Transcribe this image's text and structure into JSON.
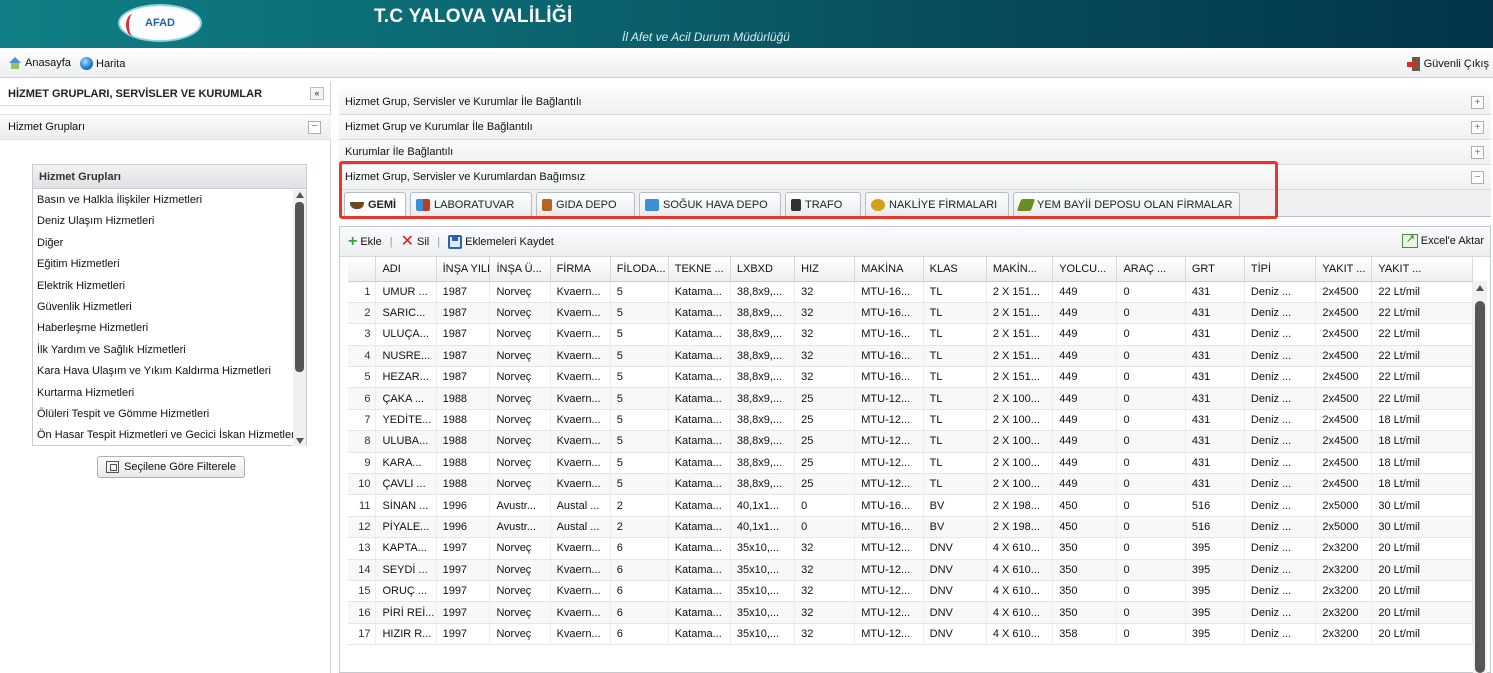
{
  "header": {
    "logo_text": "AFAD",
    "title": "T.C YALOVA VALİLİĞİ",
    "subtitle": "İl Afet ve Acil Durum Müdürlüğü"
  },
  "nav": {
    "home": "Anasayfa",
    "map": "Harita",
    "logout": "Güvenli Çıkış"
  },
  "left_panel": {
    "title": "HİZMET GRUPLARI, SERVİSLER VE KURUMLAR",
    "collapse_icon": "«",
    "section_label": "Hizmet Grupları",
    "section_toggle": "−",
    "group_box_title": "Hizmet Grupları",
    "groups": [
      "Basın ve Halkla İlişkiler Hizmetleri",
      "Deniz Ulaşım Hizmetleri",
      "Diğer",
      "Eğitim Hizmetleri",
      "Elektrik Hizmetleri",
      "Güvenlik Hizmetleri",
      "Haberleşme Hizmetleri",
      "İlk Yardım ve Sağlık Hizmetleri",
      "Kara Hava Ulaşım ve Yıkım Kaldırma Hizmetleri",
      "Kurtarma Hizmetleri",
      "Ölüleri Tespit ve Gömme Hizmetleri",
      "Ön Hasar Tespit Hizmetleri ve Gecici İskan Hizmetleri"
    ],
    "filter_button": "Seçilene Göre Filterele"
  },
  "accordion": [
    {
      "label": "Hizmet Grup, Servisler ve Kurumlar İle Bağlantılı",
      "toggle": "+"
    },
    {
      "label": "Hizmet Grup ve Kurumlar İle Bağlantılı",
      "toggle": "+"
    },
    {
      "label": "Kurumlar İle Bağlantılı",
      "toggle": "+"
    },
    {
      "label": "Hizmet Grup, Servisler ve Kurumlardan Bağımsız",
      "toggle": "−"
    }
  ],
  "tabs": [
    {
      "label": "GEMİ",
      "icon": "ship-icon",
      "color": "#6b4a1f"
    },
    {
      "label": "LABORATUVAR",
      "icon": "lab-icon",
      "color": "#c0392b"
    },
    {
      "label": "GIDA DEPO",
      "icon": "food-storage-icon",
      "color": "#b5651d"
    },
    {
      "label": "SOĞUK HAVA DEPO",
      "icon": "cold-storage-icon",
      "color": "#3b8fd6"
    },
    {
      "label": "TRAFO",
      "icon": "transformer-icon",
      "color": "#333333"
    },
    {
      "label": "NAKLİYE FİRMALARI",
      "icon": "transport-icon",
      "color": "#d4a017"
    },
    {
      "label": "YEM BAYİİ DEPOSU OLAN FİRMALAR",
      "icon": "feed-dealer-icon",
      "color": "#6b8e23"
    }
  ],
  "toolbar": {
    "add": "Ekle",
    "delete": "Sil",
    "save": "Eklemeleri Kaydet",
    "excel": "Excel'e Aktar"
  },
  "grid": {
    "columns": [
      "",
      "ADI",
      "İNŞA YILI",
      "İNŞA Ü...",
      "FİRMA",
      "FİLODA...",
      "TEKNE ...",
      "LXBXD",
      "HIZ",
      "MAKİNA",
      "KLAS",
      "MAKİN...",
      "YOLCU...",
      "ARAÇ ...",
      "GRT",
      "TİPİ",
      "YAKIT ...",
      "YAKIT ..."
    ],
    "rows": [
      [
        "1",
        "UMUR ...",
        "1987",
        "Norveç",
        "Kvaern...",
        "5",
        "Katama...",
        "38,8x9,...",
        "32",
        "MTU-16...",
        "TL",
        "2 X 151...",
        "449",
        "0",
        "431",
        "Deniz ...",
        "2x4500",
        "22 Lt/mil"
      ],
      [
        "2",
        "SARIC...",
        "1987",
        "Norveç",
        "Kvaern...",
        "5",
        "Katama...",
        "38,8x9,...",
        "32",
        "MTU-16...",
        "TL",
        "2 X 151...",
        "449",
        "0",
        "431",
        "Deniz ...",
        "2x4500",
        "22 Lt/mil"
      ],
      [
        "3",
        "ULUÇA...",
        "1987",
        "Norveç",
        "Kvaern...",
        "5",
        "Katama...",
        "38,8x9,...",
        "32",
        "MTU-16...",
        "TL",
        "2 X 151...",
        "449",
        "0",
        "431",
        "Deniz ...",
        "2x4500",
        "22 Lt/mil"
      ],
      [
        "4",
        "NUSRE...",
        "1987",
        "Norveç",
        "Kvaern...",
        "5",
        "Katama...",
        "38,8x9,...",
        "32",
        "MTU-16...",
        "TL",
        "2 X 151...",
        "449",
        "0",
        "431",
        "Deniz ...",
        "2x4500",
        "22 Lt/mil"
      ],
      [
        "5",
        "HEZAR...",
        "1987",
        "Norveç",
        "Kvaern...",
        "5",
        "Katama...",
        "38,8x9,...",
        "32",
        "MTU-16...",
        "TL",
        "2 X 151...",
        "449",
        "0",
        "431",
        "Deniz ...",
        "2x4500",
        "22 Lt/mil"
      ],
      [
        "6",
        "ÇAKA ...",
        "1988",
        "Norveç",
        "Kvaern...",
        "5",
        "Katama...",
        "38,8x9,...",
        "25",
        "MTU-12...",
        "TL",
        "2 X 100...",
        "449",
        "0",
        "431",
        "Deniz ...",
        "2x4500",
        "22 Lt/mil"
      ],
      [
        "7",
        "YEDİTE...",
        "1988",
        "Norveç",
        "Kvaern...",
        "5",
        "Katama...",
        "38,8x9,...",
        "25",
        "MTU-12...",
        "TL",
        "2 X 100...",
        "449",
        "0",
        "431",
        "Deniz ...",
        "2x4500",
        "18 Lt/mil"
      ],
      [
        "8",
        "ULUBA...",
        "1988",
        "Norveç",
        "Kvaern...",
        "5",
        "Katama...",
        "38,8x9,...",
        "25",
        "MTU-12...",
        "TL",
        "2 X 100...",
        "449",
        "0",
        "431",
        "Deniz ...",
        "2x4500",
        "18 Lt/mil"
      ],
      [
        "9",
        "KARA...",
        "1988",
        "Norveç",
        "Kvaern...",
        "5",
        "Katama...",
        "38,8x9,...",
        "25",
        "MTU-12...",
        "TL",
        "2 X 100...",
        "449",
        "0",
        "431",
        "Deniz ...",
        "2x4500",
        "18 Lt/mil"
      ],
      [
        "10",
        "ÇAVLI ...",
        "1988",
        "Norveç",
        "Kvaern...",
        "5",
        "Katama...",
        "38,8x9,...",
        "25",
        "MTU-12...",
        "TL",
        "2 X 100...",
        "449",
        "0",
        "431",
        "Deniz ...",
        "2x4500",
        "18 Lt/mil"
      ],
      [
        "11",
        "SİNAN ...",
        "1996",
        "Avustr...",
        "Austal ...",
        "2",
        "Katama...",
        "40,1x1...",
        "0",
        "MTU-16...",
        "BV",
        "2 X 198...",
        "450",
        "0",
        "516",
        "Deniz ...",
        "2x5000",
        "30 Lt/mil"
      ],
      [
        "12",
        "PİYALE...",
        "1996",
        "Avustr...",
        "Austal ...",
        "2",
        "Katama...",
        "40,1x1...",
        "0",
        "MTU-16...",
        "BV",
        "2 X 198...",
        "450",
        "0",
        "516",
        "Deniz ...",
        "2x5000",
        "30 Lt/mil"
      ],
      [
        "13",
        "KAPTA...",
        "1997",
        "Norveç",
        "Kvaern...",
        "6",
        "Katama...",
        "35x10,...",
        "32",
        "MTU-12...",
        "DNV",
        "4 X 610...",
        "350",
        "0",
        "395",
        "Deniz ...",
        "2x3200",
        "20 Lt/mil"
      ],
      [
        "14",
        "SEYDİ ...",
        "1997",
        "Norveç",
        "Kvaern...",
        "6",
        "Katama...",
        "35x10,...",
        "32",
        "MTU-12...",
        "DNV",
        "4 X 610...",
        "350",
        "0",
        "395",
        "Deniz ...",
        "2x3200",
        "20 Lt/mil"
      ],
      [
        "15",
        "ORUÇ ...",
        "1997",
        "Norveç",
        "Kvaern...",
        "6",
        "Katama...",
        "35x10,...",
        "32",
        "MTU-12...",
        "DNV",
        "4 X 610...",
        "350",
        "0",
        "395",
        "Deniz ...",
        "2x3200",
        "20 Lt/mil"
      ],
      [
        "16",
        "PİRİ REİ...",
        "1997",
        "Norveç",
        "Kvaern...",
        "6",
        "Katama...",
        "35x10,...",
        "32",
        "MTU-12...",
        "DNV",
        "4 X 610...",
        "350",
        "0",
        "395",
        "Deniz ...",
        "2x3200",
        "20 Lt/mil"
      ],
      [
        "17",
        "HIZIR R...",
        "1997",
        "Norveç",
        "Kvaern...",
        "6",
        "Katama...",
        "35x10,...",
        "32",
        "MTU-12...",
        "DNV",
        "4 X 610...",
        "358",
        "0",
        "395",
        "Deniz ...",
        "2x3200",
        "20 Lt/mil"
      ]
    ]
  },
  "colors": {
    "header_start": "#0f7f86",
    "header_end": "#03344a",
    "highlight_border": "#e9362b"
  }
}
